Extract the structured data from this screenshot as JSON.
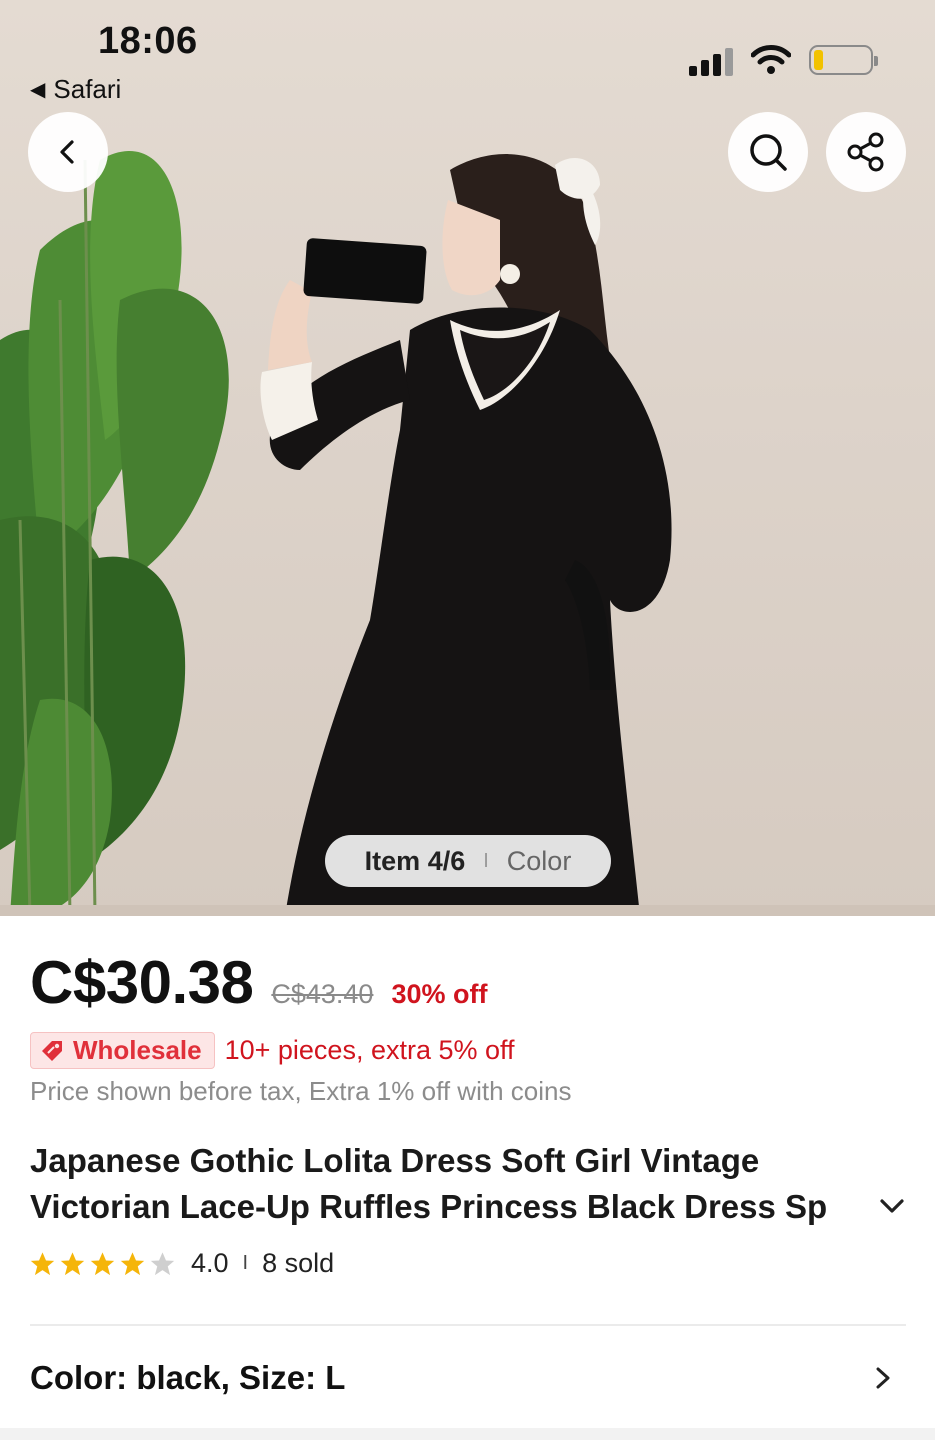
{
  "status_bar": {
    "time": "18:06",
    "back_app": "Safari"
  },
  "top_buttons": {
    "back": "chevron-left-icon",
    "search": "search-icon",
    "share": "share-icon"
  },
  "gallery": {
    "item_indicator": "Item 4/6",
    "separator": "I",
    "tab": "Color"
  },
  "pricing": {
    "price": "C$30.38",
    "original_price": "C$43.40",
    "discount": "30% off"
  },
  "wholesale": {
    "badge": "Wholesale",
    "text": "10+ pieces, extra 5% off"
  },
  "tax_note": "Price shown before tax, Extra 1% off with coins",
  "product": {
    "title_line1": "Japanese Gothic Lolita Dress Soft Girl Vintage",
    "title_line2": "Victorian Lace-Up Ruffles Princess Black Dress Sp"
  },
  "rating": {
    "score": "4.0",
    "stars": 4,
    "separator": "I",
    "sold": "8 sold"
  },
  "variant": {
    "label": "Color: black, Size: L"
  },
  "colors": {
    "accent_red": "#d0141e",
    "star_gold": "#f5b50a",
    "wholesale_bg": "#fde6e6"
  }
}
